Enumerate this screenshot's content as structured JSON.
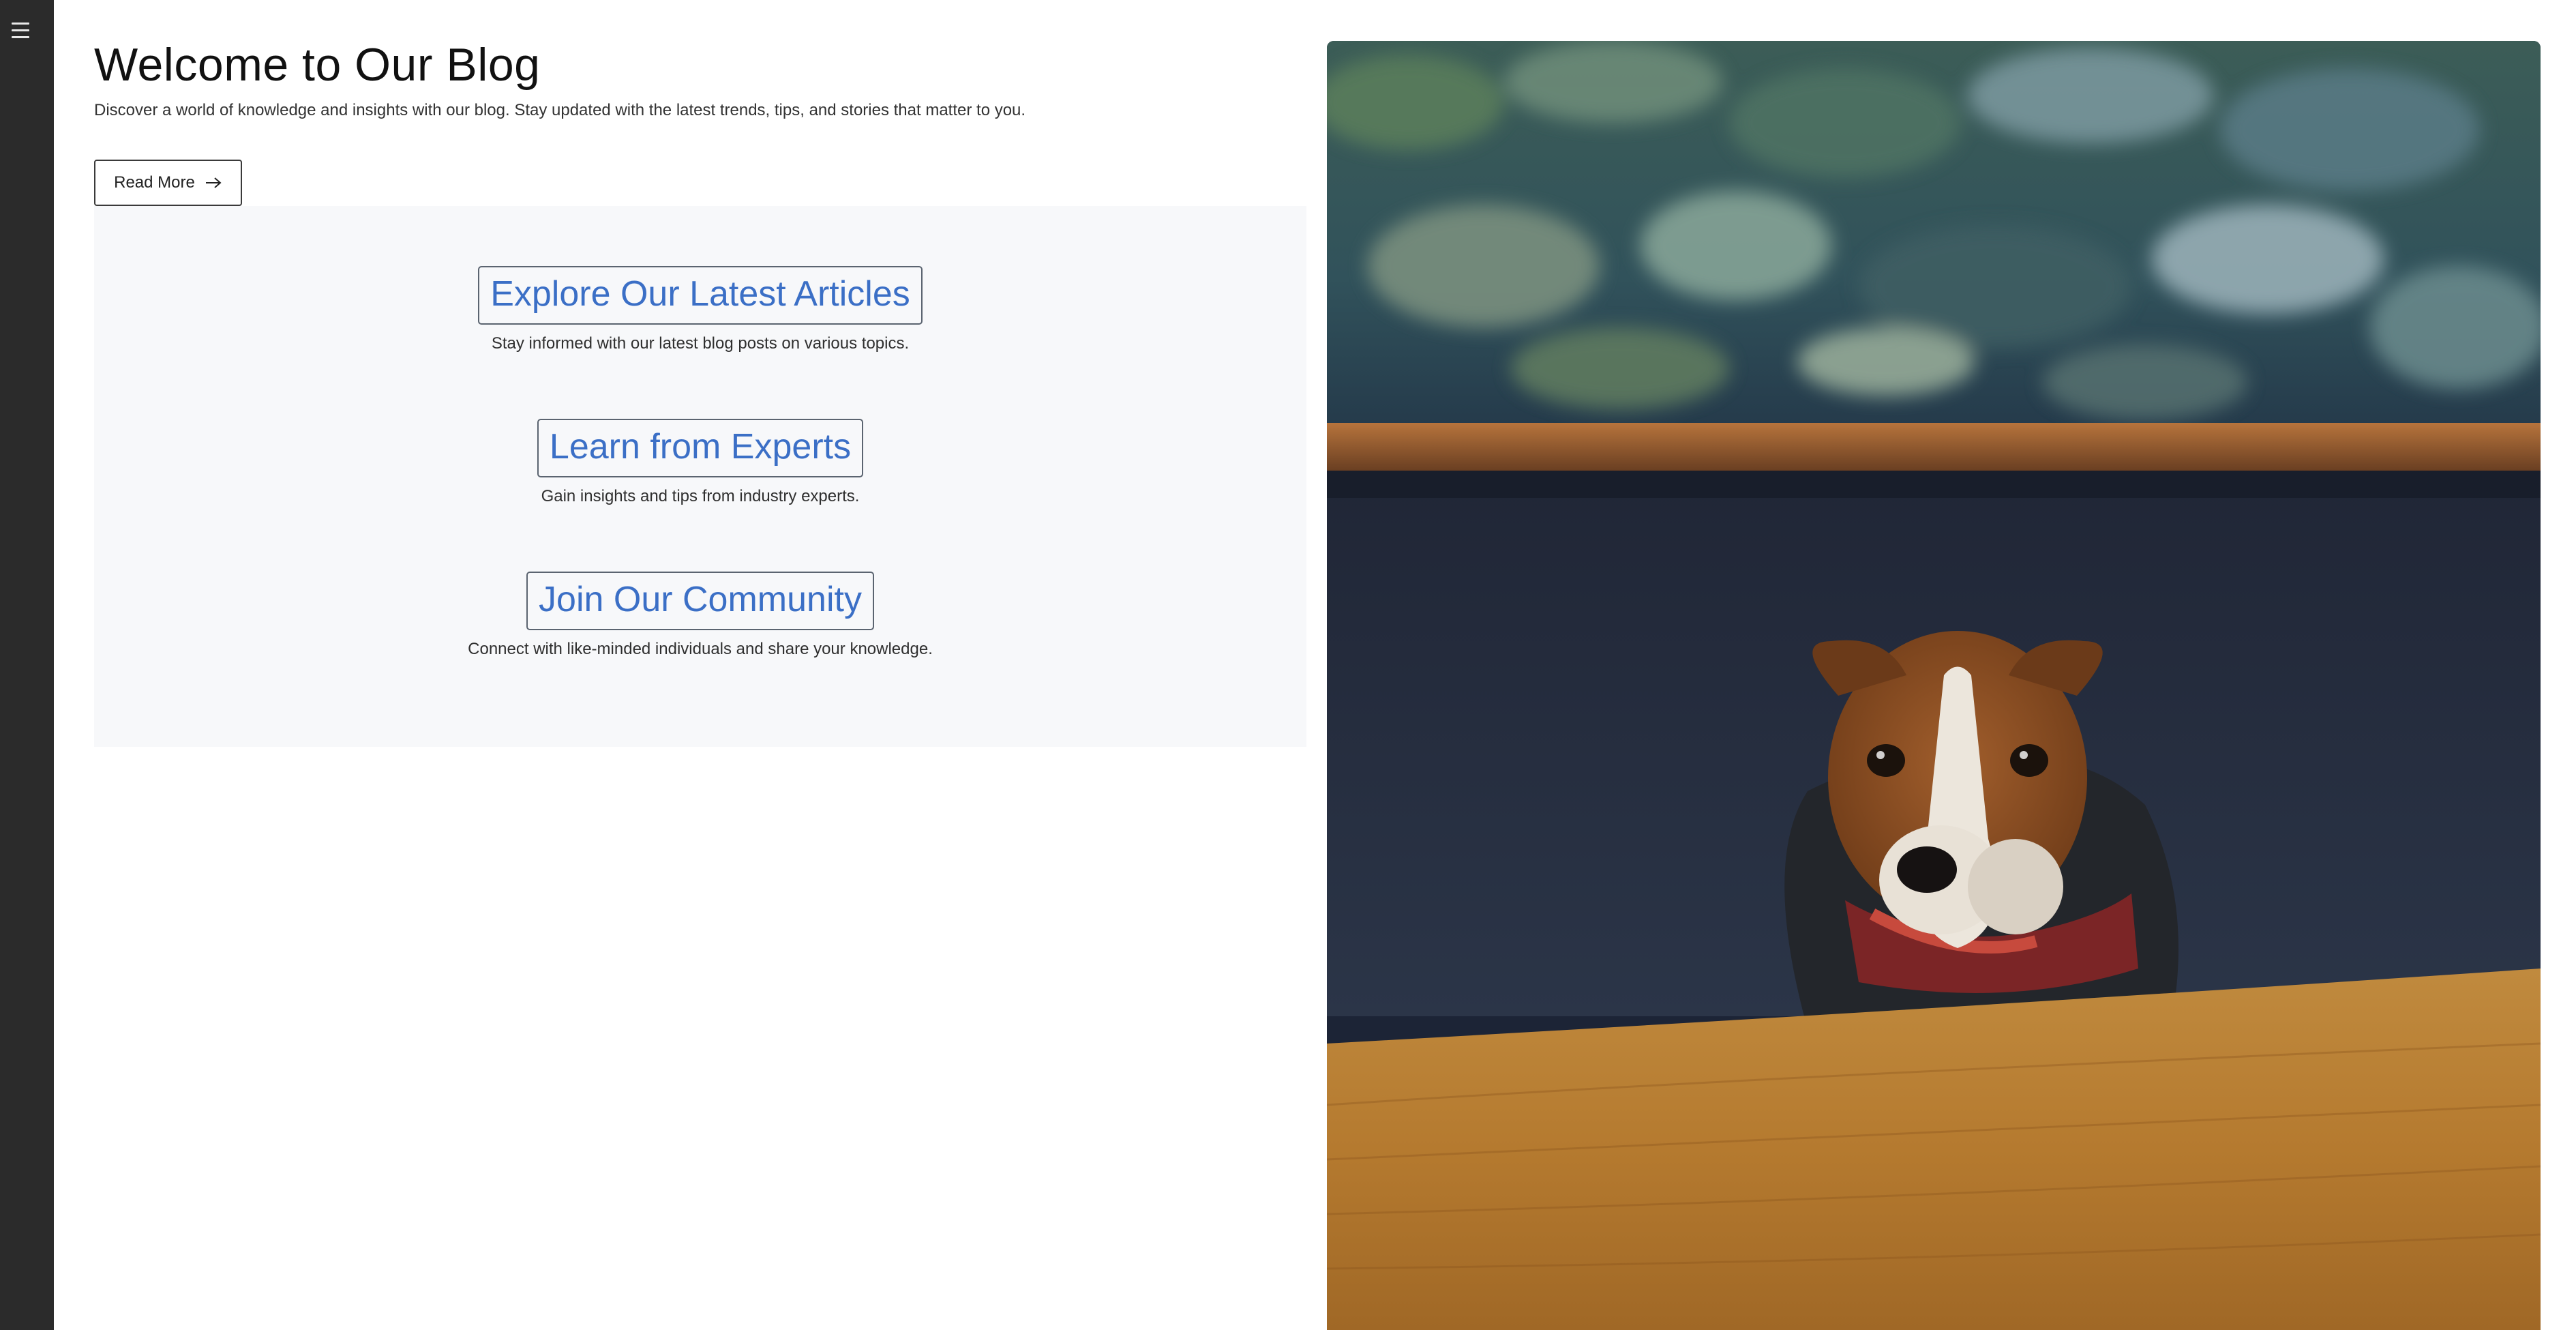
{
  "sidebar": {
    "menu_icon": "hamburger-menu-icon"
  },
  "hero": {
    "title": "Welcome to Our Blog",
    "subtitle": "Discover a world of knowledge and insights with our blog. Stay updated with the latest trends, tips, and stories that matter to you.",
    "read_more_label": "Read More",
    "read_more_icon": "arrow-right-icon"
  },
  "features": [
    {
      "title": "Explore Our Latest Articles",
      "description": "Stay informed with our latest blog posts on various topics."
    },
    {
      "title": "Learn from Experts",
      "description": "Gain insights and tips from industry experts."
    },
    {
      "title": "Join Our Community",
      "description": "Connect with like-minded individuals and share your knowledge."
    }
  ],
  "colors": {
    "sidebar_bg": "#2b2b2b",
    "link_blue": "#3b6fc6",
    "panel_bg": "#f7f8fa"
  }
}
